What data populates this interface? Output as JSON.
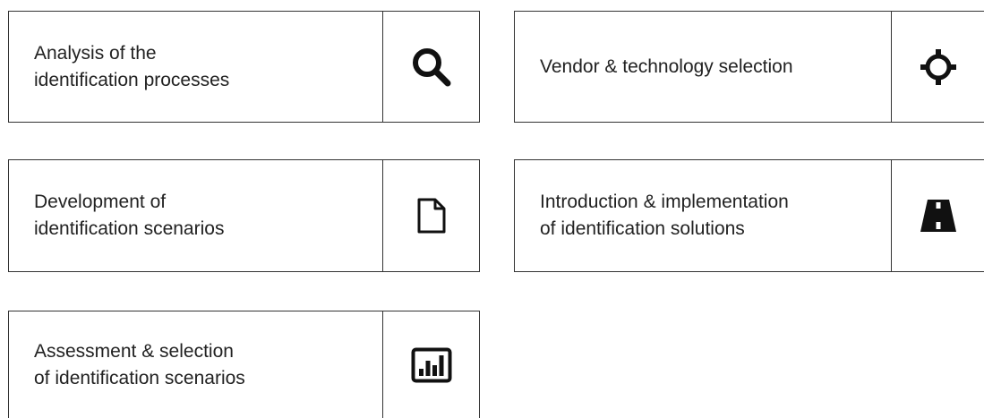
{
  "cards": [
    {
      "lines": [
        "Analysis of the",
        "identification processes"
      ],
      "icon": "search-icon"
    },
    {
      "lines": [
        "Vendor & technology selection"
      ],
      "icon": "crosshair-icon"
    },
    {
      "lines": [
        "Development of",
        "identification scenarios"
      ],
      "icon": "document-icon"
    },
    {
      "lines": [
        "Introduction & implementation",
        "of identification solutions"
      ],
      "icon": "road-icon"
    },
    {
      "lines": [
        "Assessment & selection",
        "of identification scenarios"
      ],
      "icon": "bar-chart-icon"
    }
  ],
  "colors": {
    "border": "#333333",
    "text": "#222222",
    "icon": "#111111"
  }
}
